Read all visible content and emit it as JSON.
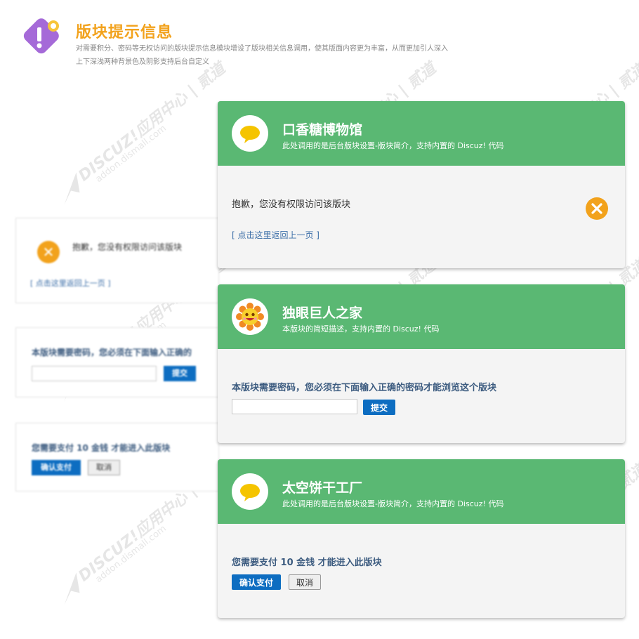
{
  "header": {
    "title": "版块提示信息",
    "desc_line1": "对需要积分、密码等无权访问的版块提示信息模块增设了版块相关信息调用，使其版面内容更为丰富，从而更加引人深入",
    "desc_line2": "上下深浅两种背景色及阴影支持后台自定义"
  },
  "watermark": {
    "line1": "DISCUZ!应用中心 | 贰道",
    "line2": "addon.dismall.com"
  },
  "preview": {
    "error_message": "抱歉，您没有权限访问该版块",
    "back_link": "[ 点击这里返回上一页 ]",
    "password_message": "本版块需要密码，您必须在下面输入正确的",
    "submit_label": "提交",
    "pay_message": "您需要支付 10 金钱 才能进入此版块",
    "confirm_label": "确认支付",
    "cancel_label": "取消"
  },
  "cards": [
    {
      "title": "口香糖博物馆",
      "subtitle": "此处调用的是后台版块设置-版块简介，支持内置的 Discuz! 代码",
      "avatar_icon": "chat-bubble-icon",
      "message": "抱歉，您没有权限访问该版块",
      "back_link": "[ 点击这里返回上一页 ]"
    },
    {
      "title": "独眼巨人之家",
      "subtitle": "本版块的简短描述，支持内置的 Discuz! 代码",
      "avatar_icon": "sun-face-icon",
      "message": "本版块需要密码，您必须在下面输入正确的密码才能浏览这个版块",
      "password_value": "",
      "submit_label": "提交"
    },
    {
      "title": "太空饼干工厂",
      "subtitle": "此处调用的是后台版块设置-版块简介，支持内置的 Discuz! 代码",
      "avatar_icon": "chat-bubble-icon",
      "message": "您需要支付 10 金钱 才能进入此版块",
      "confirm_label": "确认支付",
      "cancel_label": "取消"
    }
  ],
  "colors": {
    "header_green": "#5ab873",
    "accent_orange": "#f2a21c",
    "button_blue": "#0d6dc1",
    "message_blue": "#3d5c80"
  }
}
